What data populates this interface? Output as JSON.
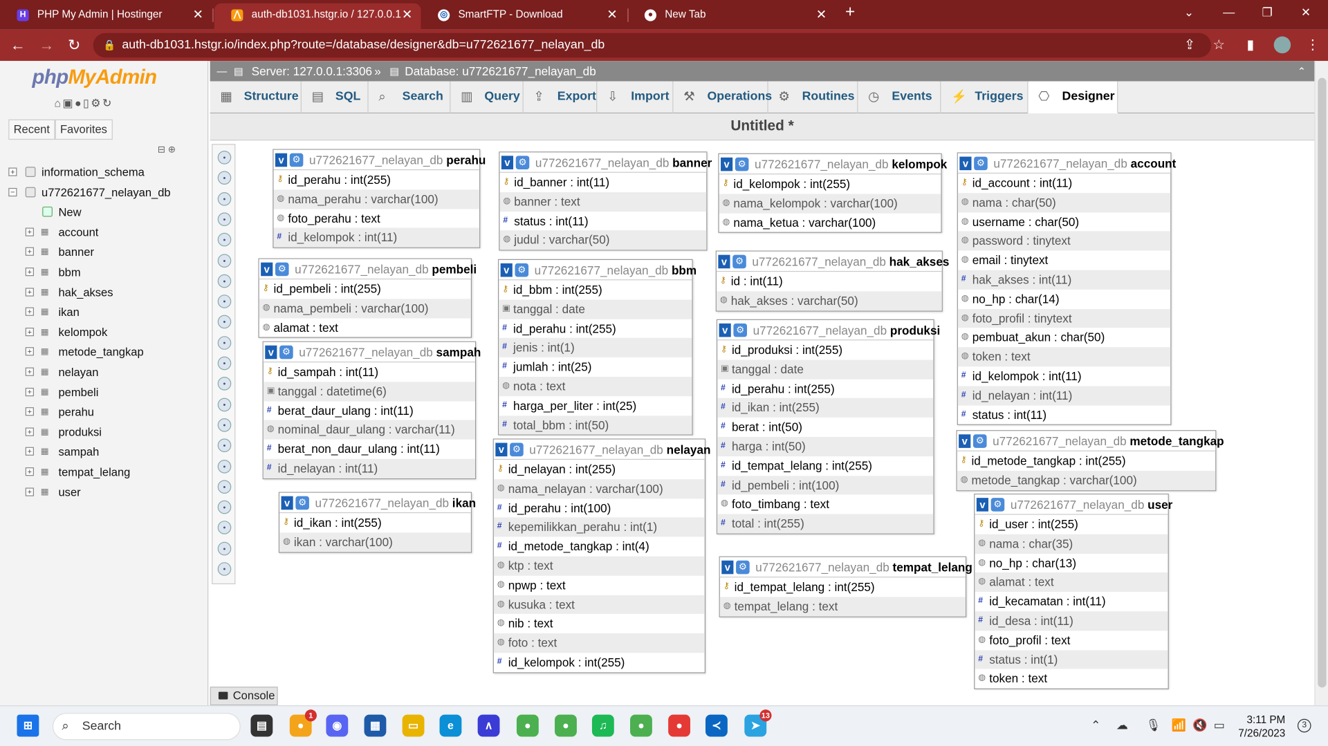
{
  "browser": {
    "tabs": [
      {
        "title": "PHP My Admin | Hostinger",
        "icon": "hostinger-icon"
      },
      {
        "title": "auth-db1031.hstgr.io / 127.0.0.1",
        "icon": "phpmyadmin-icon"
      },
      {
        "title": "SmartFTP - Download",
        "icon": "smartftp-icon"
      },
      {
        "title": "New Tab",
        "icon": "chrome-icon"
      }
    ],
    "new_tab": "+",
    "url": "auth-db1031.hstgr.io/index.php?route=/database/designer&db=u772621677_nelayan_db"
  },
  "left": {
    "logo_a": "php",
    "logo_b": "MyAdmin",
    "tab_recent": "Recent",
    "tab_favorites": "Favorites",
    "databases": [
      {
        "name": "information_schema"
      },
      {
        "name": "u772621677_nelayan_db"
      }
    ],
    "new_label": "New",
    "tables": [
      "account",
      "banner",
      "bbm",
      "hak_akses",
      "ikan",
      "kelompok",
      "metode_tangkap",
      "nelayan",
      "pembeli",
      "perahu",
      "produksi",
      "sampah",
      "tempat_lelang",
      "user"
    ]
  },
  "breadcrumb": {
    "server": "Server: 127.0.0.1:3306",
    "sep": "»",
    "database": "Database: u772621677_nelayan_db"
  },
  "menu": [
    "Structure",
    "SQL",
    "Search",
    "Query",
    "Export",
    "Import",
    "Operations",
    "Routines",
    "Events",
    "Triggers",
    "Designer"
  ],
  "designer_title": "Untitled *",
  "db_prefix": "u772621677_nelayan_db",
  "tables": [
    {
      "name": "perahu",
      "cols": [
        [
          "key",
          "id_perahu",
          "int(255)"
        ],
        [
          "txt",
          "nama_perahu",
          "varchar(100)"
        ],
        [
          "txt",
          "foto_perahu",
          "text"
        ],
        [
          "num",
          "id_kelompok",
          "int(11)"
        ]
      ]
    },
    {
      "name": "banner",
      "cols": [
        [
          "key",
          "id_banner",
          "int(11)"
        ],
        [
          "txt",
          "banner",
          "text"
        ],
        [
          "num",
          "status",
          "int(11)"
        ],
        [
          "txt",
          "judul",
          "varchar(50)"
        ]
      ]
    },
    {
      "name": "kelompok",
      "cols": [
        [
          "key",
          "id_kelompok",
          "int(255)"
        ],
        [
          "txt",
          "nama_kelompok",
          "varchar(100)"
        ],
        [
          "txt",
          "nama_ketua",
          "varchar(100)"
        ]
      ]
    },
    {
      "name": "account",
      "cols": [
        [
          "key",
          "id_account",
          "int(11)"
        ],
        [
          "txt",
          "nama",
          "char(50)"
        ],
        [
          "txt",
          "username",
          "char(50)"
        ],
        [
          "txt",
          "password",
          "tinytext"
        ],
        [
          "txt",
          "email",
          "tinytext"
        ],
        [
          "num",
          "hak_akses",
          "int(11)"
        ],
        [
          "txt",
          "no_hp",
          "char(14)"
        ],
        [
          "txt",
          "foto_profil",
          "tinytext"
        ],
        [
          "txt",
          "pembuat_akun",
          "char(50)"
        ],
        [
          "txt",
          "token",
          "text"
        ],
        [
          "num",
          "id_kelompok",
          "int(11)"
        ],
        [
          "num",
          "id_nelayan",
          "int(11)"
        ],
        [
          "num",
          "status",
          "int(11)"
        ]
      ]
    },
    {
      "name": "pembeli",
      "cols": [
        [
          "key",
          "id_pembeli",
          "int(255)"
        ],
        [
          "txt",
          "nama_pembeli",
          "varchar(100)"
        ],
        [
          "txt",
          "alamat",
          "text"
        ]
      ]
    },
    {
      "name": "bbm",
      "cols": [
        [
          "key",
          "id_bbm",
          "int(255)"
        ],
        [
          "date",
          "tanggal",
          "date"
        ],
        [
          "num",
          "id_perahu",
          "int(255)"
        ],
        [
          "num",
          "jenis",
          "int(1)"
        ],
        [
          "num",
          "jumlah",
          "int(25)"
        ],
        [
          "txt",
          "nota",
          "text"
        ],
        [
          "num",
          "harga_per_liter",
          "int(25)"
        ],
        [
          "num",
          "total_bbm",
          "int(50)"
        ]
      ]
    },
    {
      "name": "hak_akses",
      "cols": [
        [
          "key",
          "id",
          "int(11)"
        ],
        [
          "txt",
          "hak_akses",
          "varchar(50)"
        ]
      ]
    },
    {
      "name": "sampah",
      "cols": [
        [
          "key",
          "id_sampah",
          "int(11)"
        ],
        [
          "date",
          "tanggal",
          "datetime(6)"
        ],
        [
          "num",
          "berat_daur_ulang",
          "int(11)"
        ],
        [
          "txt",
          "nominal_daur_ulang",
          "varchar(11)"
        ],
        [
          "num",
          "berat_non_daur_ulang",
          "int(11)"
        ],
        [
          "num",
          "id_nelayan",
          "int(11)"
        ]
      ]
    },
    {
      "name": "produksi",
      "cols": [
        [
          "key",
          "id_produksi",
          "int(255)"
        ],
        [
          "date",
          "tanggal",
          "date"
        ],
        [
          "num",
          "id_perahu",
          "int(255)"
        ],
        [
          "num",
          "id_ikan",
          "int(255)"
        ],
        [
          "num",
          "berat",
          "int(50)"
        ],
        [
          "num",
          "harga",
          "int(50)"
        ],
        [
          "num",
          "id_tempat_lelang",
          "int(255)"
        ],
        [
          "num",
          "id_pembeli",
          "int(100)"
        ],
        [
          "txt",
          "foto_timbang",
          "text"
        ],
        [
          "num",
          "total",
          "int(255)"
        ]
      ]
    },
    {
      "name": "nelayan",
      "cols": [
        [
          "key",
          "id_nelayan",
          "int(255)"
        ],
        [
          "txt",
          "nama_nelayan",
          "varchar(100)"
        ],
        [
          "num",
          "id_perahu",
          "int(100)"
        ],
        [
          "num",
          "kepemilikkan_perahu",
          "int(1)"
        ],
        [
          "num",
          "id_metode_tangkap",
          "int(4)"
        ],
        [
          "txt",
          "ktp",
          "text"
        ],
        [
          "txt",
          "npwp",
          "text"
        ],
        [
          "txt",
          "kusuka",
          "text"
        ],
        [
          "txt",
          "nib",
          "text"
        ],
        [
          "txt",
          "foto",
          "text"
        ],
        [
          "num",
          "id_kelompok",
          "int(255)"
        ]
      ]
    },
    {
      "name": "metode_tangkap",
      "cols": [
        [
          "key",
          "id_metode_tangkap",
          "int(255)"
        ],
        [
          "txt",
          "metode_tangkap",
          "varchar(100)"
        ]
      ]
    },
    {
      "name": "ikan",
      "cols": [
        [
          "key",
          "id_ikan",
          "int(255)"
        ],
        [
          "txt",
          "ikan",
          "varchar(100)"
        ]
      ]
    },
    {
      "name": "tempat_lelang",
      "cols": [
        [
          "key",
          "id_tempat_lelang",
          "int(255)"
        ],
        [
          "txt",
          "tempat_lelang",
          "text"
        ]
      ]
    },
    {
      "name": "user",
      "cols": [
        [
          "key",
          "id_user",
          "int(255)"
        ],
        [
          "txt",
          "nama",
          "char(35)"
        ],
        [
          "txt",
          "no_hp",
          "char(13)"
        ],
        [
          "txt",
          "alamat",
          "text"
        ],
        [
          "num",
          "id_kecamatan",
          "int(11)"
        ],
        [
          "num",
          "id_desa",
          "int(11)"
        ],
        [
          "txt",
          "foto_profil",
          "text"
        ],
        [
          "num",
          "status",
          "int(1)"
        ],
        [
          "txt",
          "token",
          "text"
        ]
      ]
    }
  ],
  "console": "Console",
  "taskbar": {
    "search": "Search",
    "time": "3:11 PM",
    "date": "7/26/2023",
    "notif_count": "3",
    "badges": {
      "app1": "1",
      "telegram": "13"
    }
  }
}
